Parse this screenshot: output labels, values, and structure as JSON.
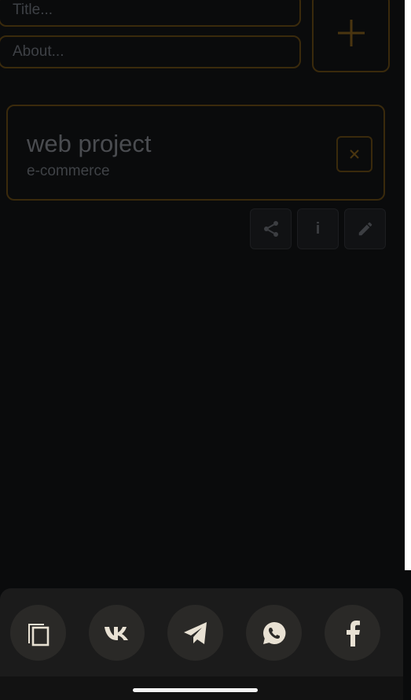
{
  "form": {
    "title_placeholder": "Title...",
    "about_placeholder": "About..."
  },
  "project": {
    "title": "web project",
    "subtitle": "e-commerce"
  },
  "actions": {
    "info_label": "i"
  },
  "share_sheet": {
    "targets": [
      "copy-icon",
      "vk-icon",
      "telegram-icon",
      "whatsapp-icon",
      "facebook-icon"
    ]
  },
  "colors": {
    "background": "#0a0b0c",
    "accent_border": "#3a2a0c",
    "sheet": "#1b1b1b",
    "sheet_button": "#2a2927",
    "sheet_icon": "#e8e1d3"
  }
}
